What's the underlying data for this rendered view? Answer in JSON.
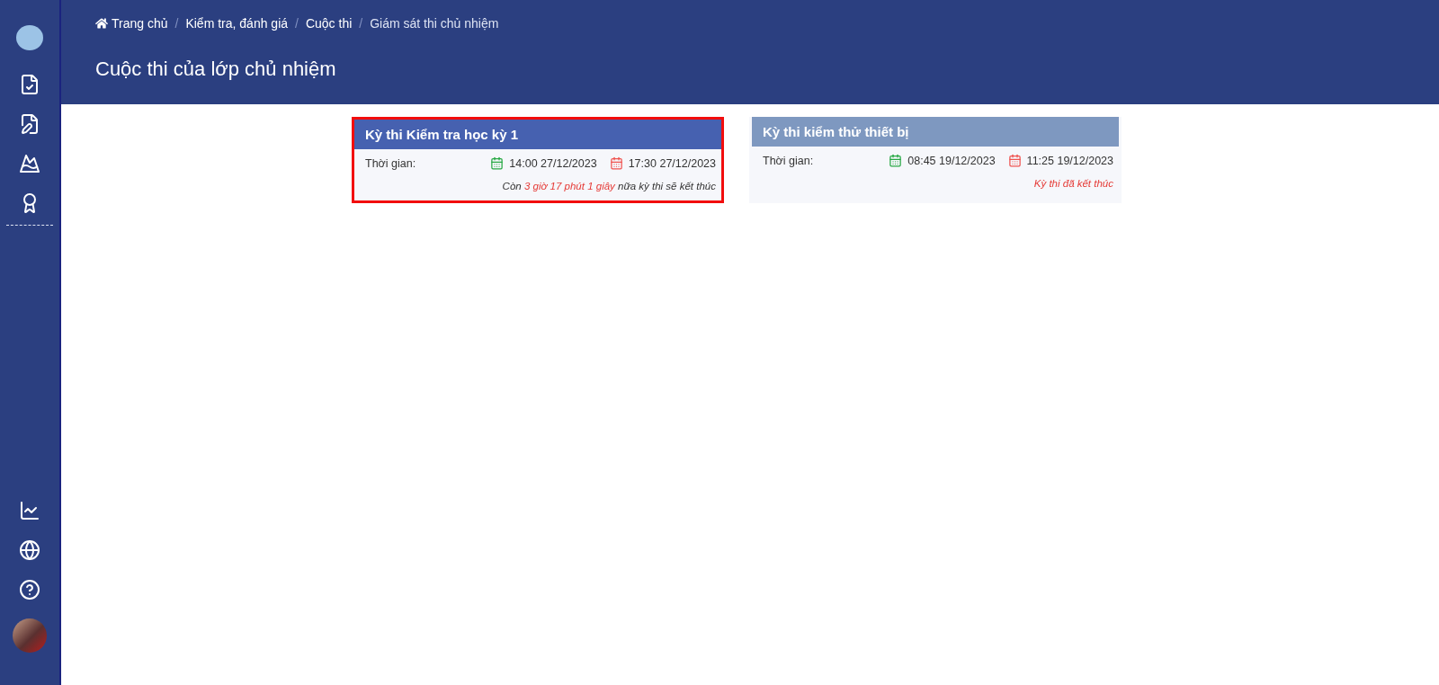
{
  "breadcrumb": [
    {
      "label": "Trang chủ",
      "kind": "home"
    },
    {
      "label": "Kiểm tra, đánh giá",
      "kind": "link"
    },
    {
      "label": "Cuộc thi",
      "kind": "link"
    },
    {
      "label": "Giám sát thi chủ nhiệm",
      "kind": "current"
    }
  ],
  "breadcrumb_separator": "/",
  "page_title": "Cuộc thi của lớp chủ nhiệm",
  "sidebar": {
    "top": [
      {
        "kind": "doc-check"
      },
      {
        "kind": "doc-edit"
      },
      {
        "kind": "mountain"
      },
      {
        "kind": "certificate"
      }
    ],
    "bottom": [
      {
        "kind": "chart"
      },
      {
        "kind": "globe"
      },
      {
        "kind": "help"
      },
      {
        "kind": "avatar"
      }
    ]
  },
  "exams": [
    {
      "title": "Kỳ thi Kiểm tra học kỳ 1",
      "kind": "ongoing",
      "selected": true,
      "time_label": "Thời gian:",
      "start": "14:00 27/12/2023",
      "end": "17:30 27/12/2023",
      "note": {
        "before": "Còn",
        "remaining": "3 giờ 17 phút 1 giây",
        "after": "nữa kỳ thi sẽ kết thúc"
      }
    },
    {
      "title": "Kỳ thi kiểm thử thiết bị",
      "kind": "ended",
      "selected": false,
      "time_label": "Thời gian:",
      "start": "08:45 19/12/2023",
      "end": "11:25 19/12/2023",
      "note": {
        "message": "Kỳ thi đã kết thúc"
      }
    }
  ]
}
